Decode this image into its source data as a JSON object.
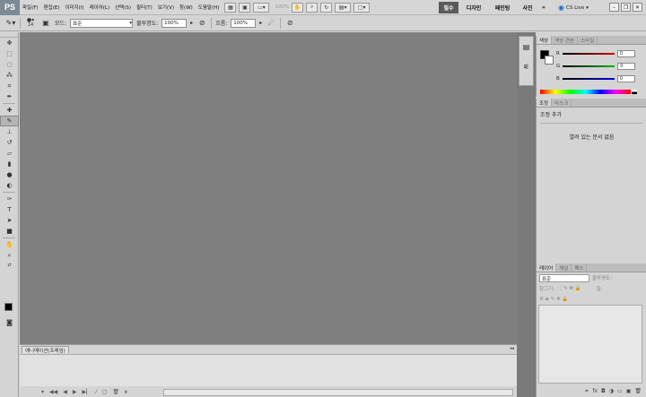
{
  "menubar": {
    "logo": "PS",
    "menus": [
      "파일(F)",
      "편집(E)",
      "이미지(I)",
      "레이어(L)",
      "선택(S)",
      "필터(T)",
      "보기(V)",
      "창(W)",
      "도움말(H)"
    ],
    "zoom": "100%",
    "workspaces": [
      {
        "label": "필수",
        "active": true
      },
      {
        "label": "디자인",
        "active": false
      },
      {
        "label": "페인팅",
        "active": false
      },
      {
        "label": "사진",
        "active": false
      }
    ],
    "more": "»",
    "cs_live": "CS Live"
  },
  "options": {
    "brush_size": "14",
    "mode_label": "모드:",
    "mode_value": "표준",
    "opacity_label": "불투명도:",
    "opacity_value": "100%",
    "flow_label": "흐름:",
    "flow_value": "100%"
  },
  "color_panel": {
    "tabs": [
      "색상",
      "색상 견본",
      "스타일"
    ],
    "rows": [
      {
        "label": "R",
        "value": "0",
        "color": "#d40000"
      },
      {
        "label": "G",
        "value": "0",
        "color": "#00b400"
      },
      {
        "label": "B",
        "value": "0",
        "color": "#0000d4"
      }
    ]
  },
  "adjust_panel": {
    "tabs": [
      "조정",
      "마스크"
    ],
    "title": "조정 추가",
    "message": "열려 있는 문서 없음"
  },
  "layers_panel": {
    "tabs": [
      "레이어",
      "채널",
      "패스"
    ],
    "blend_mode": "표준",
    "opacity_label": "불투명도:",
    "lock_label": "잠그기:",
    "fill_label": "칠:"
  },
  "animation_panel": {
    "tab": "애니메이션(프레임)"
  }
}
